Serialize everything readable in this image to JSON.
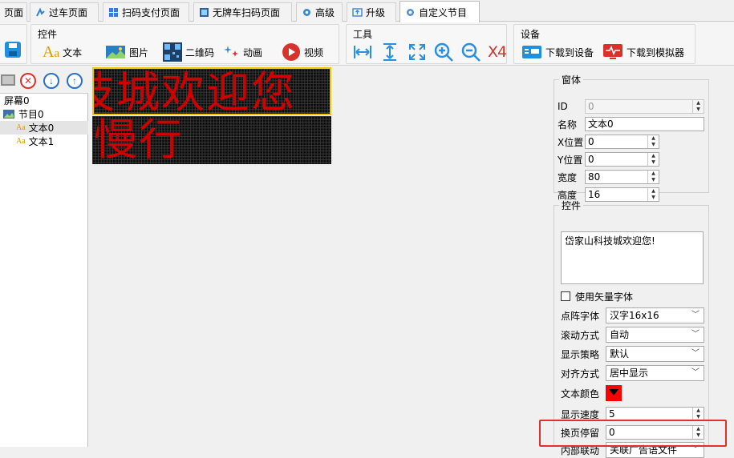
{
  "tabs": [
    {
      "label": "页面"
    },
    {
      "label": "过车页面"
    },
    {
      "label": "扫码支付页面"
    },
    {
      "label": "无牌车扫码页面"
    },
    {
      "label": "高级"
    },
    {
      "label": "升级"
    },
    {
      "label": "自定义节目",
      "active": true
    }
  ],
  "ribbon": {
    "controls_group": "控件",
    "buttons": {
      "text": "文本",
      "image": "图片",
      "qrcode": "二维码",
      "animation": "动画",
      "video": "视频"
    },
    "tools_group": "工具",
    "zoom_label": "X4",
    "device_group": "设备",
    "download_device": "下载到设备",
    "download_sim": "下载到模拟器"
  },
  "tree": {
    "screen": "屏幕0",
    "program": "节目0",
    "items": [
      "文本0",
      "文本1"
    ]
  },
  "led": {
    "line1": "技城欢迎您",
    "line2": "慢行"
  },
  "window_props": {
    "title": "窗体",
    "id_label": "ID",
    "id_value": "0",
    "name_label": "名称",
    "name_value": "文本0",
    "x_label": "X位置",
    "x_value": "0",
    "y_label": "Y位置",
    "y_value": "0",
    "w_label": "宽度",
    "w_value": "80",
    "h_label": "高度",
    "h_value": "16"
  },
  "control_props": {
    "title": "控件",
    "text_value": "岱家山科技城欢迎您!",
    "vector_font_label": "使用矢量字体",
    "font_label": "点阵字体",
    "font_value": "汉字16x16",
    "scroll_label": "滚动方式",
    "scroll_value": "自动",
    "strategy_label": "显示策略",
    "strategy_value": "默认",
    "align_label": "对齐方式",
    "align_value": "居中显示",
    "color_label": "文本颜色",
    "color_value": "#ff0000",
    "speed_label": "显示速度",
    "speed_value": "5",
    "pause_label": "换页停留",
    "pause_value": "0",
    "link_label": "内部联动",
    "link_value": "关联广告语文件"
  }
}
